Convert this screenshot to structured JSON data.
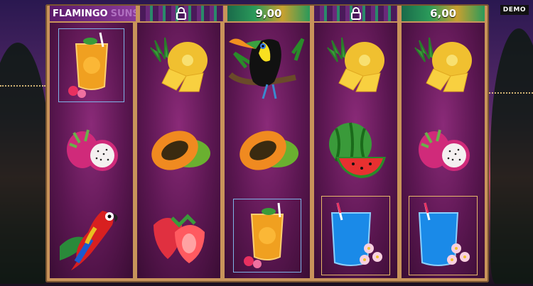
{
  "game": {
    "title": "FLAMINGO",
    "title_faded": "SUNS",
    "mode_badge": "DEMO"
  },
  "reel_headers": [
    {
      "type": "title"
    },
    {
      "type": "locked",
      "icon": "lock-icon"
    },
    {
      "type": "value",
      "value": "9,00"
    },
    {
      "type": "locked",
      "icon": "lock-icon"
    },
    {
      "type": "value",
      "value": "6,00"
    }
  ],
  "reels": [
    [
      "cocktail-orange",
      "dragonfruit",
      "parrot"
    ],
    [
      "pineapple",
      "papaya",
      "strawberry"
    ],
    [
      "toucan",
      "papaya",
      "cocktail-orange"
    ],
    [
      "pineapple",
      "watermelon",
      "cocktail-blue"
    ],
    [
      "pineapple",
      "dragonfruit",
      "cocktail-blue"
    ]
  ],
  "colors": {
    "frame": "#c8935a",
    "reel_bg": "#5c1752",
    "highlight_gold": "#e8b86a",
    "highlight_blue": "#7fb4e8"
  }
}
